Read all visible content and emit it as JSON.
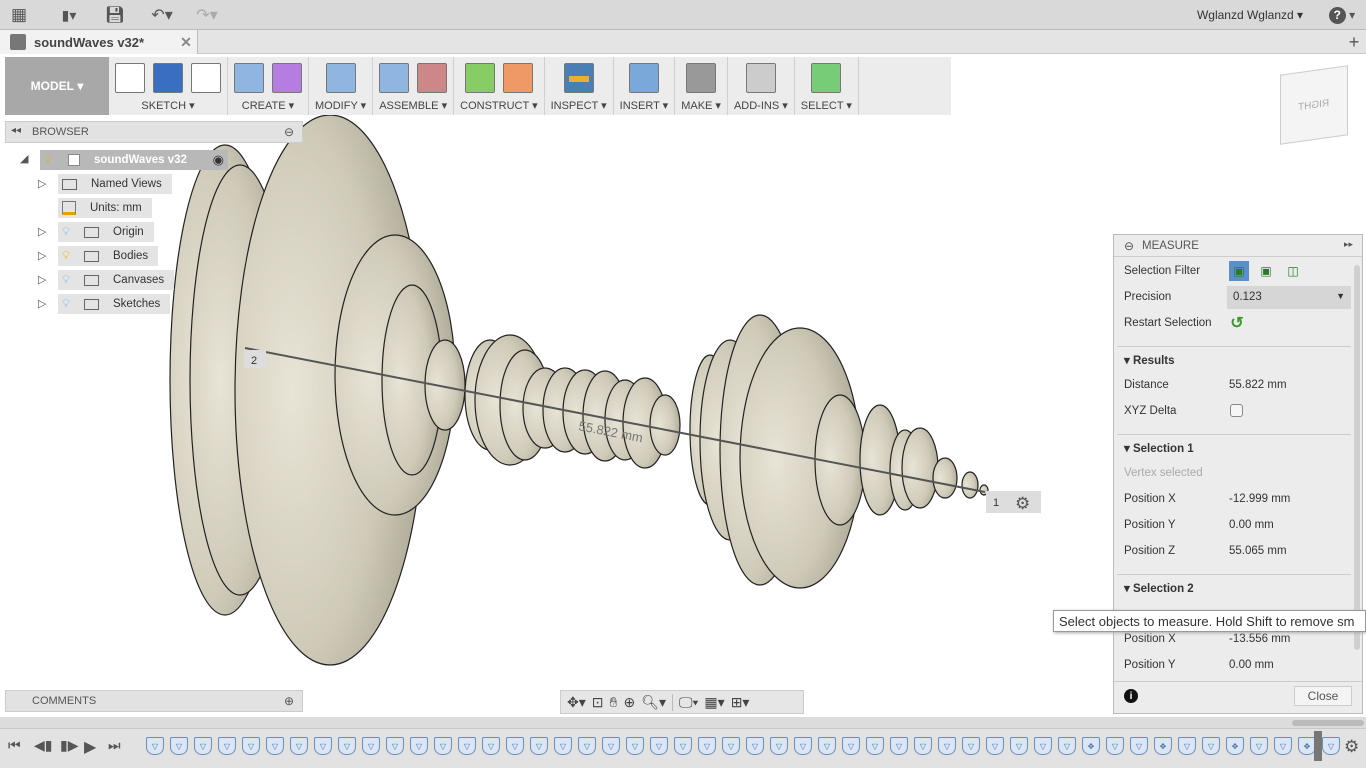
{
  "topbar": {
    "user": "Wglanzd Wglanzd",
    "help": "?"
  },
  "document_tab": {
    "title": "soundWaves v32*"
  },
  "toolbar": {
    "workspace": "MODEL",
    "groups": [
      {
        "label": "SKETCH",
        "key": "sketch"
      },
      {
        "label": "CREATE",
        "key": "create"
      },
      {
        "label": "MODIFY",
        "key": "modify"
      },
      {
        "label": "ASSEMBLE",
        "key": "assemble"
      },
      {
        "label": "CONSTRUCT",
        "key": "construct"
      },
      {
        "label": "INSPECT",
        "key": "inspect"
      },
      {
        "label": "INSERT",
        "key": "insert"
      },
      {
        "label": "MAKE",
        "key": "make"
      },
      {
        "label": "ADD-INS",
        "key": "add-ins"
      },
      {
        "label": "SELECT",
        "key": "select"
      }
    ]
  },
  "viewcube": {
    "face": "RIGHT"
  },
  "browser": {
    "title": "BROWSER",
    "root": "soundWaves v32",
    "items": [
      {
        "label": "Named Views"
      },
      {
        "label": "Units: mm"
      },
      {
        "label": "Origin"
      },
      {
        "label": "Bodies"
      },
      {
        "label": "Canvases"
      },
      {
        "label": "Sketches"
      }
    ]
  },
  "viewport": {
    "point1": "1",
    "point2": "2",
    "distance_label": "55.822 mm"
  },
  "measure": {
    "title": "MEASURE",
    "selection_filter": "Selection Filter",
    "precision_label": "Precision",
    "precision_value": "0.123",
    "restart": "Restart Selection",
    "results": {
      "title": "Results",
      "distance_label": "Distance",
      "distance": "55.822 mm",
      "xyz_delta": "XYZ Delta",
      "xyz_delta_checked": false
    },
    "selection1": {
      "title": "Selection 1",
      "status": "Vertex selected",
      "px_label": "Position X",
      "px": "-12.999 mm",
      "py_label": "Position Y",
      "py": "0.00 mm",
      "pz_label": "Position Z",
      "pz": "55.065 mm"
    },
    "selection2": {
      "title": "Selection 2",
      "px_label": "Position X",
      "px": "-13.556 mm",
      "py_label": "Position Y",
      "py": "0.00 mm"
    },
    "close": "Close"
  },
  "tooltip": "Select objects to measure. Hold Shift to remove sm",
  "comments": {
    "title": "COMMENTS"
  },
  "colors": {
    "accent": "#5b8fc7",
    "body": "#d8d4c4",
    "inspect_active": "#4a7fb5"
  }
}
